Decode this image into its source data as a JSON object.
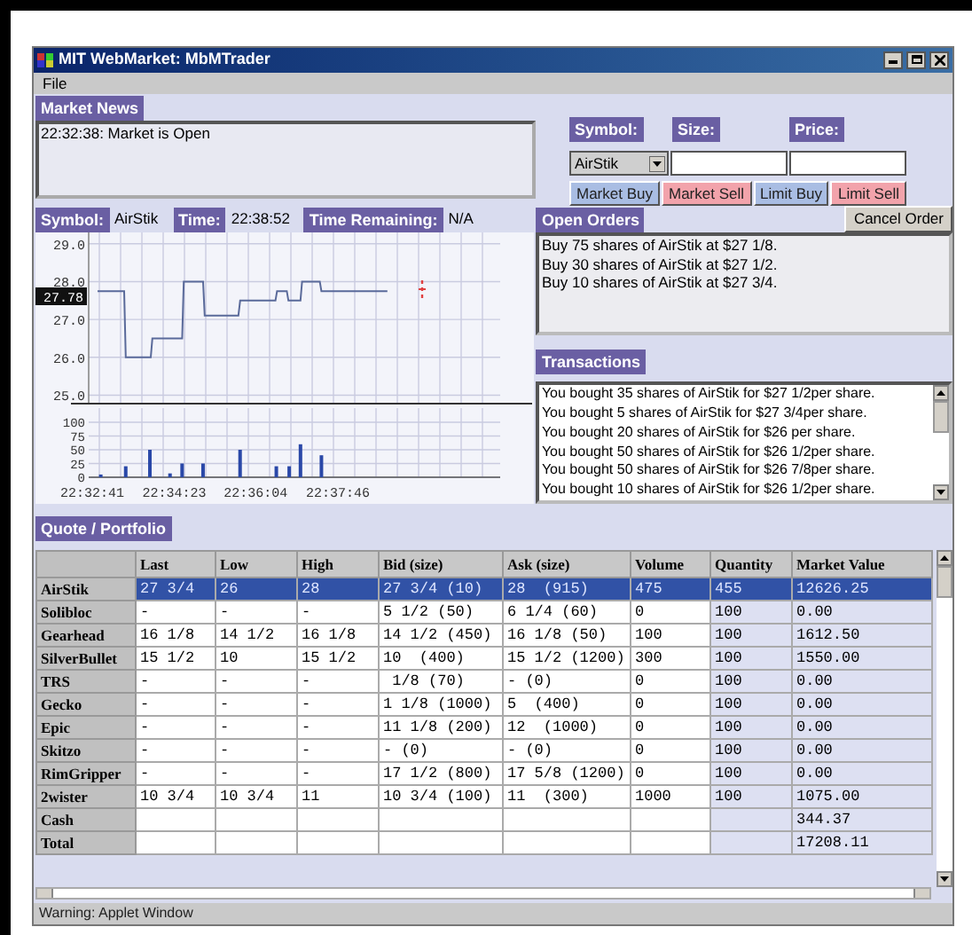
{
  "window": {
    "title": "MIT WebMarket: MbMTrader"
  },
  "menu": [
    {
      "label": "File"
    }
  ],
  "market_news": {
    "title": "Market News",
    "lines": [
      "22:32:38: Market is Open"
    ]
  },
  "order_entry": {
    "symbol_label": "Symbol:",
    "symbol_value": "AirStik",
    "size_label": "Size:",
    "price_label": "Price:",
    "buttons": [
      {
        "label": "Market Buy",
        "kind": "buy"
      },
      {
        "label": "Market Sell",
        "kind": "sell"
      },
      {
        "label": "Limit Buy",
        "kind": "buy"
      },
      {
        "label": "Limit Sell",
        "kind": "sell"
      }
    ]
  },
  "chart_panel": {
    "symbol_label": "Symbol:",
    "symbol": "AirStik",
    "time_label": "Time:",
    "time": "22:38:52",
    "remaining_label": "Time Remaining:",
    "remaining": "N/A",
    "current_price": "27.78",
    "price_chart": {
      "chart_data": {
        "type": "line",
        "grid": true,
        "x": [
          81172,
          81205,
          81207,
          81238,
          81240,
          81277,
          81279,
          81303,
          81305,
          81347,
          81349,
          81393,
          81395,
          81407,
          81409,
          81424,
          81426,
          81448,
          81450,
          81532
        ],
        "series": [
          {
            "color": "#5a6a9a",
            "values": [
              27.75,
              27.75,
              26,
              26,
              26.5,
              26.5,
              28,
              28,
              27.1,
              27.1,
              27.5,
              27.5,
              27.75,
              27.75,
              27.5,
              27.5,
              28,
              28,
              27.75,
              27.75
            ]
          }
        ],
        "xlim": [
          81161,
          81672
        ],
        "ylim": [
          24.8,
          29.3
        ],
        "yticks": [
          {
            "value": 25,
            "label": "25.0"
          },
          {
            "value": 26,
            "label": "26.0"
          },
          {
            "value": 27,
            "label": "27.0"
          },
          {
            "value": 28,
            "label": "28.0"
          },
          {
            "value": 29,
            "label": "29.0"
          }
        ]
      }
    },
    "volume_chart": {
      "chart_data": {
        "type": "bar",
        "grid": true,
        "x": [
          81176,
          81207,
          81237,
          81262,
          81277,
          81303,
          81349,
          81394,
          81410,
          81424,
          81450
        ],
        "series": [
          {
            "color": "#2a48a8",
            "values": [
              5,
              20,
              50,
              7,
              25,
              25,
              50,
              20,
              20,
              60,
              40
            ]
          }
        ],
        "xlim": [
          81161,
          81672
        ],
        "ylim": [
          0,
          100
        ],
        "yticks": [
          0,
          25,
          50,
          75,
          100
        ],
        "xticks": [
          {
            "value": 81161,
            "label": "22:32:41"
          },
          {
            "value": 81263,
            "label": "22:34:23"
          },
          {
            "value": 81364,
            "label": "22:36:04"
          },
          {
            "value": 81466,
            "label": "22:37:46"
          }
        ]
      }
    }
  },
  "open_orders": {
    "title": "Open Orders",
    "cancel_button": "Cancel Order",
    "orders": [
      "Buy 75 shares of AirStik at $27 1/8.",
      "Buy 30 shares of AirStik at $27 1/2.",
      "Buy 10 shares of AirStik at $27 3/4."
    ]
  },
  "transactions": {
    "title": "Transactions",
    "lines": [
      "You bought 35 shares of AirStik for $27 1/2per share.",
      "You bought 5 shares of AirStik for $27 3/4per share.",
      "You bought 20 shares of AirStik for $26 per share.",
      "You bought 50 shares of AirStik for $26 1/2per share.",
      "You bought 50 shares of AirStik for $26 7/8per share.",
      "You bought 10 shares of AirStik for $26 1/2per share."
    ]
  },
  "portfolio": {
    "title": "Quote / Portfolio",
    "columns": [
      "Last",
      "Low",
      "High",
      "Bid (size)",
      "Ask (size)",
      "Volume",
      "Quantity",
      "Market Value"
    ],
    "rows": [
      {
        "kind": "stock",
        "name": "AirStik",
        "selected": true,
        "cells": [
          "27 3/4",
          "26",
          "28",
          "27 3/4 (10)",
          "28  (915)",
          "475",
          "455",
          "12626.25"
        ]
      },
      {
        "kind": "stock",
        "name": "Solibloc",
        "selected": false,
        "cells": [
          "-",
          "-",
          "-",
          "5 1/2 (50)",
          "6 1/4 (60)",
          "0",
          "100",
          "0.00"
        ]
      },
      {
        "kind": "stock",
        "name": "Gearhead",
        "selected": false,
        "cells": [
          "16 1/8",
          "14 1/2",
          "16 1/8",
          "14 1/2 (450)",
          "16 1/8 (50)",
          "100",
          "100",
          "1612.50"
        ]
      },
      {
        "kind": "stock",
        "name": "SilverBullet",
        "selected": false,
        "cells": [
          "15 1/2",
          "10",
          "15 1/2",
          "10  (400)",
          "15 1/2 (1200)",
          "300",
          "100",
          "1550.00"
        ]
      },
      {
        "kind": "stock",
        "name": "TRS",
        "selected": false,
        "cells": [
          "-",
          "-",
          "-",
          " 1/8 (70)",
          "- (0)",
          "0",
          "100",
          "0.00"
        ]
      },
      {
        "kind": "stock",
        "name": "Gecko",
        "selected": false,
        "cells": [
          "-",
          "-",
          "-",
          "1 1/8 (1000)",
          "5  (400)",
          "0",
          "100",
          "0.00"
        ]
      },
      {
        "kind": "stock",
        "name": "Epic",
        "selected": false,
        "cells": [
          "-",
          "-",
          "-",
          "11 1/8 (200)",
          "12  (1000)",
          "0",
          "100",
          "0.00"
        ]
      },
      {
        "kind": "stock",
        "name": "Skitzo",
        "selected": false,
        "cells": [
          "-",
          "-",
          "-",
          "- (0)",
          "- (0)",
          "0",
          "100",
          "0.00"
        ]
      },
      {
        "kind": "stock",
        "name": "RimGripper",
        "selected": false,
        "cells": [
          "-",
          "-",
          "-",
          "17 1/2 (800)",
          "17 5/8 (1200)",
          "0",
          "100",
          "0.00"
        ]
      },
      {
        "kind": "stock",
        "name": "2wister",
        "selected": false,
        "cells": [
          "10 3/4",
          "10 3/4",
          "11",
          "10 3/4 (100)",
          "11  (300)",
          "1000",
          "100",
          "1075.00"
        ]
      },
      {
        "kind": "summary",
        "name": "Cash",
        "market_value": "344.37"
      },
      {
        "kind": "summary",
        "name": "Total",
        "market_value": "17208.11"
      }
    ]
  },
  "status_bar": "Warning: Applet Window"
}
